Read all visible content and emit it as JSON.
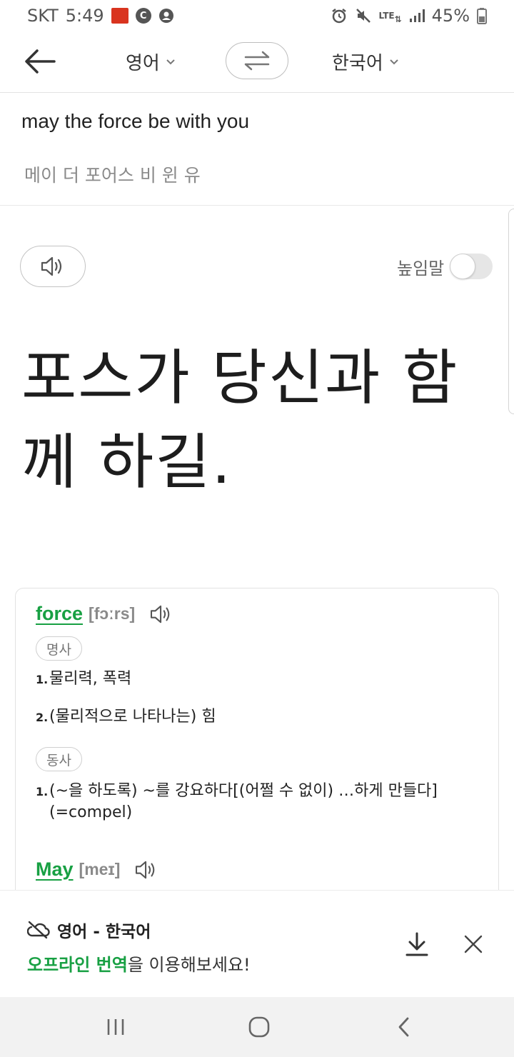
{
  "status_bar": {
    "carrier": "SKT",
    "time": "5:49",
    "network": "LTE",
    "battery": "45%"
  },
  "header": {
    "source_language": "영어",
    "target_language": "한국어"
  },
  "input": {
    "text": "may the force be with you",
    "pronunciation": "메이 더 포어스 비 윈 유"
  },
  "result": {
    "honorific_label": "높임말",
    "honorific_on": false,
    "translation": "포스가 당신과 함께 하길."
  },
  "dictionary": {
    "entries": [
      {
        "word": "force",
        "phonetic": "[fɔːrs]",
        "groups": [
          {
            "pos": "명사",
            "definitions": [
              "물리력, 폭력",
              "(물리적으로 나타나는) 힘"
            ]
          },
          {
            "pos": "동사",
            "definitions": [
              "(~을 하도록) ~를 강요하다[(어쩔 수 없이) …하게 만들다] (=compel)"
            ]
          }
        ]
      },
      {
        "word": "May",
        "phonetic": "[meɪ]"
      }
    ]
  },
  "offline_banner": {
    "title": "영어 - 한국어",
    "highlight": "오프라인 번역",
    "rest": "을 이용해보세요!"
  },
  "colors": {
    "accent_green": "#18a043",
    "status_red": "#d9341f"
  },
  "icons": [
    "back-arrow-icon",
    "chevron-down-icon",
    "swap-icon",
    "speaker-icon",
    "cloud-off-icon",
    "download-icon",
    "close-icon",
    "recent-apps-icon",
    "home-icon",
    "back-nav-icon"
  ]
}
